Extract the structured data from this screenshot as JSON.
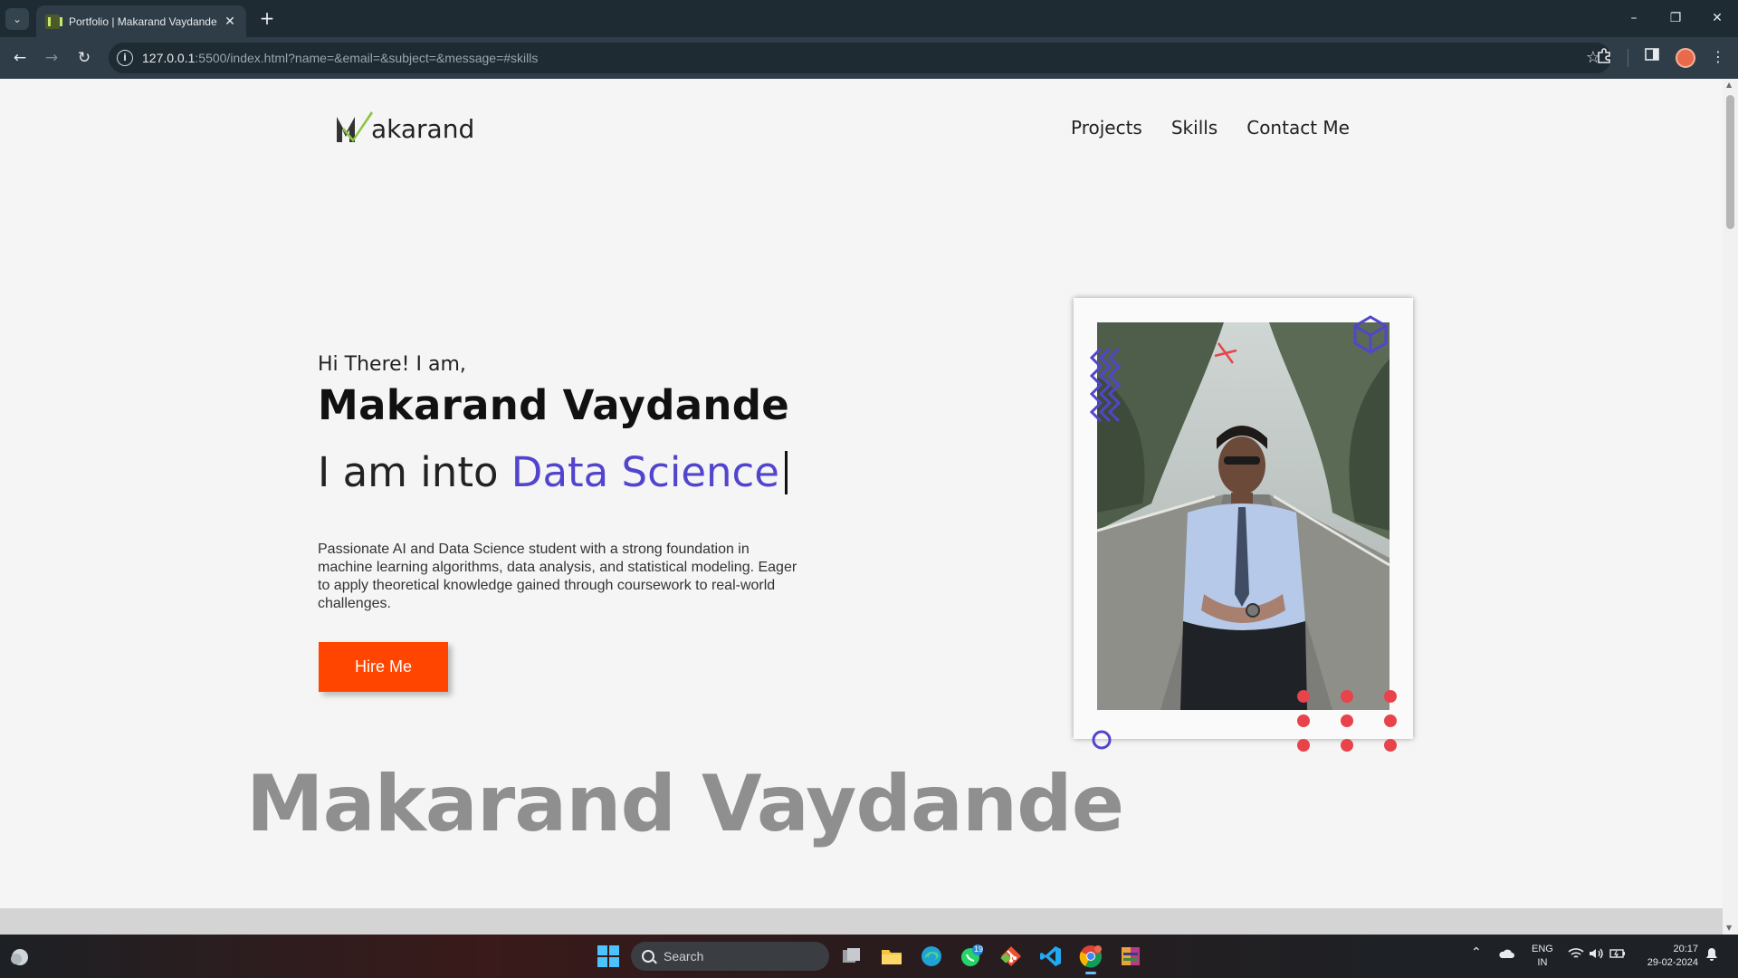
{
  "browser": {
    "tab_title": "Portfolio | Makarand Vaydande",
    "url_host": "127.0.0.1",
    "url_rest": ":5500/index.html?name=&email=&subject=&message=#skills"
  },
  "site": {
    "logo_text": "akarand",
    "nav": [
      "Projects",
      "Skills",
      "Contact Me"
    ],
    "hero": {
      "greeting": "Hi There! I am,",
      "name": "Makarand Vaydande",
      "tagline_prefix": "I am into ",
      "tagline_highlight": "Data Science",
      "bio": "Passionate AI and Data Science student with a strong foundation in machine learning algorithms, data analysis, and statistical modeling. Eager to apply theoretical knowledge gained through coursework to real-world challenges.",
      "cta": "Hire Me"
    },
    "footer_name": "Makarand Vaydande"
  },
  "taskbar": {
    "search_label": "Search",
    "whatsapp_badge": "19",
    "lang_line1": "ENG",
    "lang_line2": "IN",
    "time": "20:17",
    "date": "29-02-2024"
  },
  "colors": {
    "accent_purple": "#5145cd",
    "cta_orange": "#ff4500",
    "dot_red": "#e8434b",
    "logo_green": "#8cc63f"
  }
}
